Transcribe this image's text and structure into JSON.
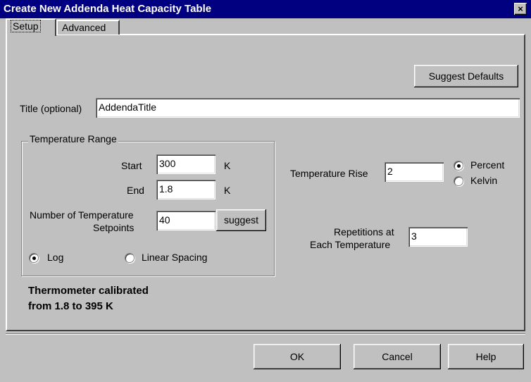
{
  "window": {
    "title": "Create New Addenda Heat Capacity Table",
    "close_glyph": "×"
  },
  "tabs": [
    {
      "label": "Setup",
      "active": true
    },
    {
      "label": "Advanced",
      "active": false
    }
  ],
  "buttons": {
    "suggest_defaults": "Suggest Defaults",
    "suggest": "suggest",
    "ok": "OK",
    "cancel": "Cancel",
    "help": "Help"
  },
  "title_field": {
    "label": "Title (optional)",
    "value": "AddendaTitle"
  },
  "temperature_range": {
    "legend": "Temperature Range",
    "start": {
      "label": "Start",
      "value": "300",
      "unit": "K"
    },
    "end": {
      "label": "End",
      "value": "1.8",
      "unit": "K"
    },
    "setpoints": {
      "label_line1": "Number of Temperature",
      "label_line2": "Setpoints",
      "value": "40"
    },
    "spacing": {
      "log_label": "Log",
      "linear_label": "Linear Spacing",
      "selected": "log"
    }
  },
  "temperature_rise": {
    "label": "Temperature Rise",
    "value": "2",
    "percent_label": "Percent",
    "kelvin_label": "Kelvin",
    "selected": "percent"
  },
  "repetitions": {
    "label_line1": "Repetitions at",
    "label_line2": "Each Temperature",
    "value": "3"
  },
  "calibration": {
    "line1": "Thermometer calibrated",
    "line2": "from 1.8 to 395 K"
  }
}
